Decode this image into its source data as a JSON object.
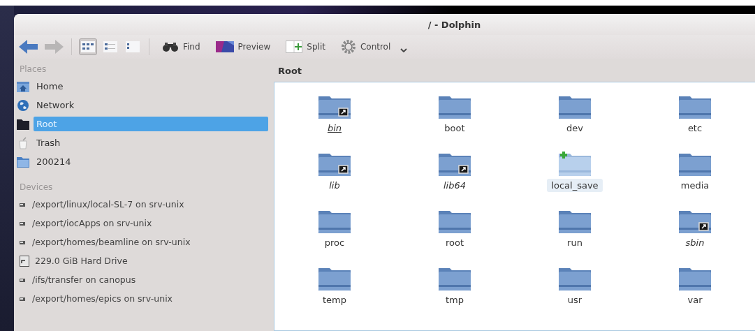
{
  "window": {
    "title": "/ - Dolphin"
  },
  "toolbar": {
    "view_modes": [
      {
        "kind": "icons",
        "selected": true
      },
      {
        "kind": "compact",
        "selected": false
      },
      {
        "kind": "details",
        "selected": false
      }
    ],
    "buttons": [
      {
        "kind": "find",
        "label": "Find"
      },
      {
        "kind": "preview",
        "label": "Preview"
      },
      {
        "kind": "split",
        "label": "Split"
      },
      {
        "kind": "control",
        "label": "Control"
      }
    ]
  },
  "places": {
    "title": "Places",
    "items": [
      {
        "kind": "home",
        "label": "Home",
        "selected": false
      },
      {
        "kind": "network",
        "label": "Network",
        "selected": false
      },
      {
        "kind": "root",
        "label": "Root",
        "selected": true
      },
      {
        "kind": "trash",
        "label": "Trash",
        "selected": false
      },
      {
        "kind": "folder",
        "label": "200214",
        "selected": false
      }
    ]
  },
  "devices": {
    "title": "Devices",
    "items": [
      {
        "kind": "share",
        "label": "/export/linux/local-SL-7 on srv-unix"
      },
      {
        "kind": "share",
        "label": "/export/iocApps on srv-unix"
      },
      {
        "kind": "share",
        "label": "/export/homes/beamline on srv-unix"
      },
      {
        "kind": "drive",
        "label": "229.0 GiB Hard Drive"
      },
      {
        "kind": "share",
        "label": "/ifs/transfer on canopus"
      },
      {
        "kind": "share",
        "label": "/export/homes/epics on srv-unix"
      }
    ]
  },
  "location": {
    "title": "Root"
  },
  "files": [
    {
      "name": "bin",
      "kind": "link",
      "selected": false,
      "focused": true
    },
    {
      "name": "boot",
      "kind": "folder",
      "selected": false,
      "focused": false
    },
    {
      "name": "dev",
      "kind": "folder",
      "selected": false,
      "focused": false
    },
    {
      "name": "etc",
      "kind": "folder",
      "selected": false,
      "focused": false
    },
    {
      "name": "lib",
      "kind": "link",
      "selected": false,
      "focused": false
    },
    {
      "name": "lib64",
      "kind": "link",
      "selected": false,
      "focused": false
    },
    {
      "name": "local_save",
      "kind": "added",
      "selected": true,
      "focused": false
    },
    {
      "name": "media",
      "kind": "folder",
      "selected": false,
      "focused": false
    },
    {
      "name": "proc",
      "kind": "folder",
      "selected": false,
      "focused": false
    },
    {
      "name": "root",
      "kind": "folder",
      "selected": false,
      "focused": false
    },
    {
      "name": "run",
      "kind": "folder",
      "selected": false,
      "focused": false
    },
    {
      "name": "sbin",
      "kind": "link",
      "selected": false,
      "focused": false
    },
    {
      "name": "temp",
      "kind": "folder",
      "selected": false,
      "focused": false
    },
    {
      "name": "tmp",
      "kind": "folder",
      "selected": false,
      "focused": false
    },
    {
      "name": "usr",
      "kind": "folder",
      "selected": false,
      "focused": false
    },
    {
      "name": "var",
      "kind": "folder",
      "selected": false,
      "focused": false
    }
  ]
}
